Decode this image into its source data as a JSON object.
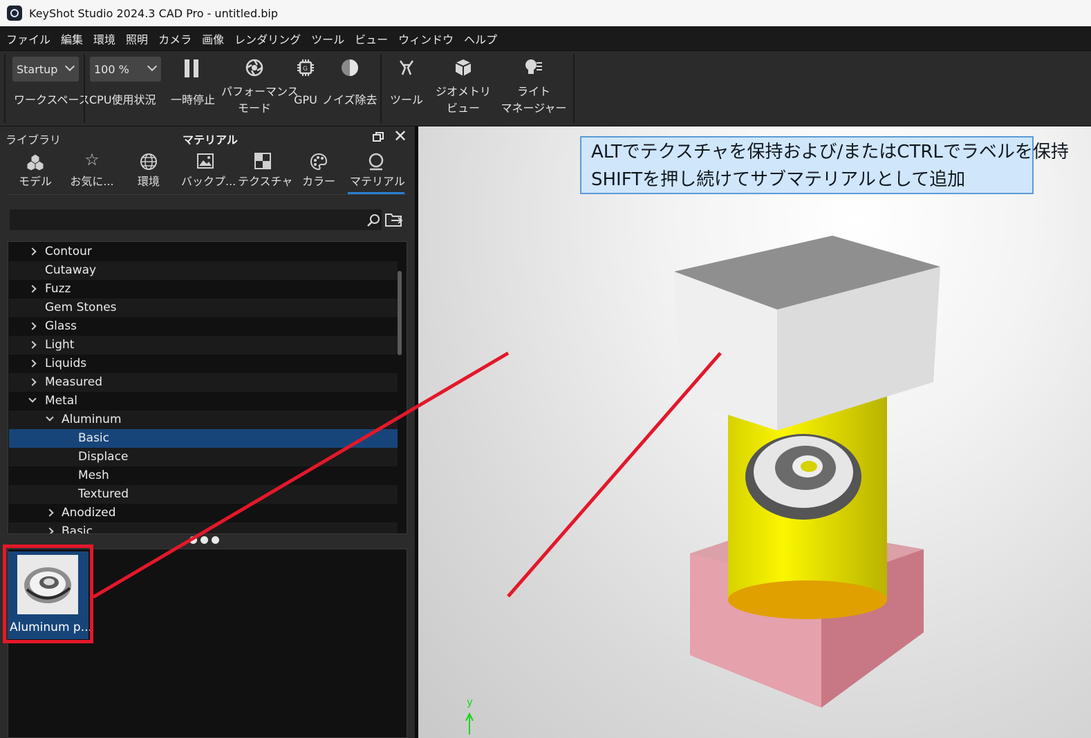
{
  "window": {
    "title": "KeyShot Studio 2024.3 CAD Pro - untitled.bip"
  },
  "menu": [
    "ファイル",
    "編集",
    "環境",
    "照明",
    "カメラ",
    "画像",
    "レンダリング",
    "ツール",
    "ビュー",
    "ウィンドウ",
    "ヘルプ"
  ],
  "toolbar": {
    "workspace_value": "Startup",
    "workspace_label": "ワークスペース",
    "cpu_value": "100 %",
    "cpu_label": "CPU使用状況",
    "pause_label": "一時停止",
    "performance_line1": "パフォーマンス",
    "performance_line2": "モード",
    "gpu_label": "GPU",
    "denoise_label": "ノイズ除去",
    "tools_label": "ツール",
    "geometry_line1": "ジオメトリ",
    "geometry_line2": "ビュー",
    "light_line1": "ライト",
    "light_line2": "マネージャー"
  },
  "library": {
    "header_left": "ライブラリ",
    "header_center": "マテリアル",
    "tabs": [
      "モデル",
      "お気に...",
      "環境",
      "バックプ...",
      "テクスチャ",
      "カラー",
      "マテリアル"
    ],
    "active_tab": "マテリアル",
    "search_placeholder": "",
    "tree": [
      {
        "label": "Contour",
        "arrow": "right"
      },
      {
        "label": "Cutaway",
        "arrow": "none"
      },
      {
        "label": "Fuzz",
        "arrow": "right"
      },
      {
        "label": "Gem Stones",
        "arrow": "none"
      },
      {
        "label": "Glass",
        "arrow": "right"
      },
      {
        "label": "Light",
        "arrow": "right"
      },
      {
        "label": "Liquids",
        "arrow": "right"
      },
      {
        "label": "Measured",
        "arrow": "right"
      },
      {
        "label": "Metal",
        "arrow": "down"
      },
      {
        "label": "Aluminum",
        "arrow": "down"
      },
      {
        "label": "Basic",
        "arrow": "none",
        "selected": true
      },
      {
        "label": "Displace",
        "arrow": "none"
      },
      {
        "label": "Mesh",
        "arrow": "none"
      },
      {
        "label": "Textured",
        "arrow": "none"
      },
      {
        "label": "Anodized",
        "arrow": "right"
      },
      {
        "label": "Basic",
        "arrow": "right"
      }
    ],
    "thumbnail_label": "Aluminum p..."
  },
  "viewport": {
    "hint_line1": "ALTでテクスチャを保持および/またはCTRLでラベルを保持",
    "hint_line2": "SHIFTを押し続けてサブマテリアルとして追加",
    "axis_label": "y"
  },
  "colors": {
    "accent": "#2a7fd4",
    "selection": "#17457a",
    "annotation_red": "#e3182a",
    "hint_bg": "#cfe6fb"
  }
}
